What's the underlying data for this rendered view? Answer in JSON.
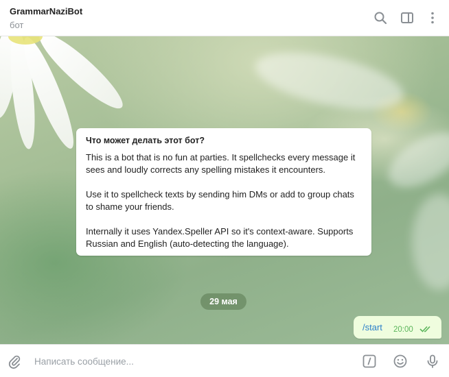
{
  "header": {
    "title": "GrammarNaziBot",
    "subtitle": "бот",
    "icons": [
      "search-icon",
      "sidebar-toggle-icon",
      "more-vertical-icon"
    ]
  },
  "bot_info": {
    "title": "Что может делать этот бот?",
    "paragraphs": [
      "This is a bot that is no fun at parties. It spellchecks every message it sees and loudly corrects any spelling mistakes it encounters.",
      "Use it to spellcheck texts by sending him DMs or add to group chats to shame your friends.",
      "Internally it uses Yandex.Speller API so it's context-aware. Supports Russian and English (auto-detecting the language)."
    ]
  },
  "date_separator": "29 мая",
  "messages": [
    {
      "text": "/start",
      "time": "20:00",
      "status": "read"
    }
  ],
  "composer": {
    "placeholder": "Написать сообщение...",
    "icons": [
      "attach-icon",
      "bot-commands-icon",
      "emoji-icon",
      "microphone-icon"
    ]
  },
  "colors": {
    "outgoing_bubble": "#effdde",
    "link_text": "#2b7fc9",
    "time_read": "#5bb55b"
  }
}
